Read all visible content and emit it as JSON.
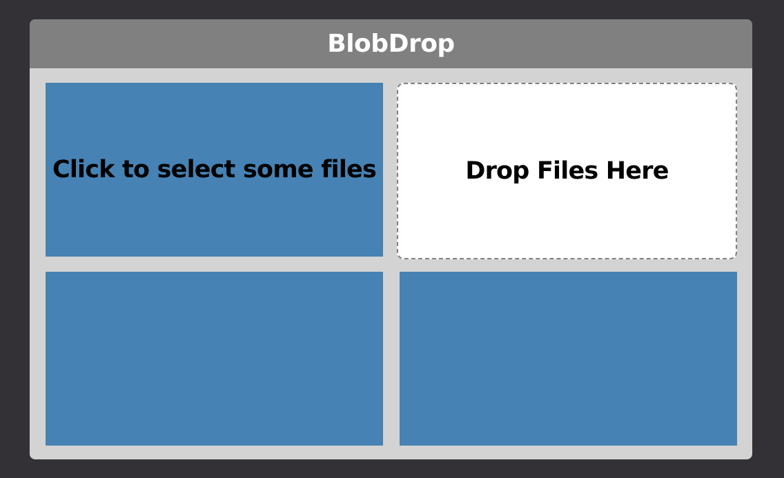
{
  "app": {
    "title": "BlobDrop"
  },
  "panels": {
    "select_files_label": "Click to select some files",
    "drop_zone_label": "Drop Files Here"
  },
  "colors": {
    "background": "#333136",
    "window": "#d3d3d3",
    "titlebar": "#808080",
    "panel_accent": "#4682b4",
    "drop_zone": "#ffffff"
  }
}
